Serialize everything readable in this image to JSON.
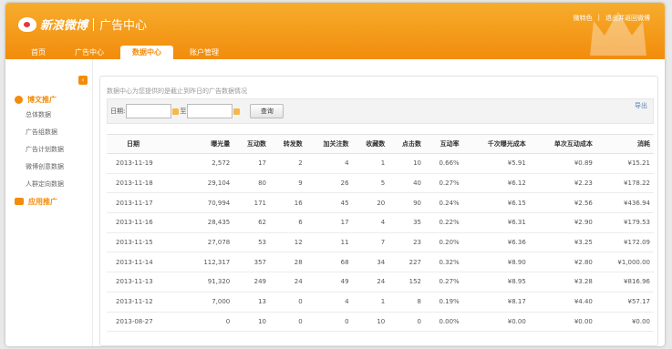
{
  "header": {
    "logo_name": "新浪微博",
    "logo_sub": "广告中心",
    "user_link": "微特色",
    "divider": "|",
    "exit_link": "退出并返回微博"
  },
  "tabs": [
    {
      "label": "首页",
      "active": false
    },
    {
      "label": "广告中心",
      "active": false
    },
    {
      "label": "数据中心",
      "active": true
    },
    {
      "label": "账户管理",
      "active": false
    }
  ],
  "sidebar": {
    "collapse_icon": "‹",
    "sections": [
      {
        "title": "博文推广",
        "icon": "weibo-icon",
        "items": [
          "总体数据",
          "广告组数据",
          "广告计划数据",
          "微博创意数据",
          "人群定向数据"
        ]
      },
      {
        "title": "应用推广",
        "icon": "app-icon",
        "items": []
      }
    ]
  },
  "main": {
    "notice": "数据中心为您提供的是截止到昨日的广告数据情况",
    "export": "导出",
    "filter": {
      "date_label": "日期:",
      "to_label": "至",
      "query_button": "查询"
    },
    "table": {
      "headers": [
        "日期",
        "曝光量",
        "互动数",
        "转发数",
        "加关注数",
        "收藏数",
        "点击数",
        "互动率",
        "千次曝光成本",
        "单次互动成本",
        "消耗"
      ],
      "rows": [
        [
          "2013-11-19",
          "2,572",
          "17",
          "2",
          "4",
          "1",
          "10",
          "0.66%",
          "¥5.91",
          "¥0.89",
          "¥15.21"
        ],
        [
          "2013-11-18",
          "29,104",
          "80",
          "9",
          "26",
          "5",
          "40",
          "0.27%",
          "¥6.12",
          "¥2.23",
          "¥178.22"
        ],
        [
          "2013-11-17",
          "70,994",
          "171",
          "16",
          "45",
          "20",
          "90",
          "0.24%",
          "¥6.15",
          "¥2.56",
          "¥436.94"
        ],
        [
          "2013-11-16",
          "28,435",
          "62",
          "6",
          "17",
          "4",
          "35",
          "0.22%",
          "¥6.31",
          "¥2.90",
          "¥179.53"
        ],
        [
          "2013-11-15",
          "27,078",
          "53",
          "12",
          "11",
          "7",
          "23",
          "0.20%",
          "¥6.36",
          "¥3.25",
          "¥172.09"
        ],
        [
          "2013-11-14",
          "112,317",
          "357",
          "28",
          "68",
          "34",
          "227",
          "0.32%",
          "¥8.90",
          "¥2.80",
          "¥1,000.00"
        ],
        [
          "2013-11-13",
          "91,320",
          "249",
          "24",
          "49",
          "24",
          "152",
          "0.27%",
          "¥8.95",
          "¥3.28",
          "¥816.96"
        ],
        [
          "2013-11-12",
          "7,000",
          "13",
          "0",
          "4",
          "1",
          "8",
          "0.19%",
          "¥8.17",
          "¥4.40",
          "¥57.17"
        ],
        [
          "2013-08-27",
          "0",
          "10",
          "0",
          "0",
          "10",
          "0",
          "0.00%",
          "¥0.00",
          "¥0.00",
          "¥0.00"
        ]
      ]
    }
  },
  "colors": {
    "brand": "#f28c0c",
    "header_light": "#f7ac2c",
    "link": "#5a7fb6"
  }
}
